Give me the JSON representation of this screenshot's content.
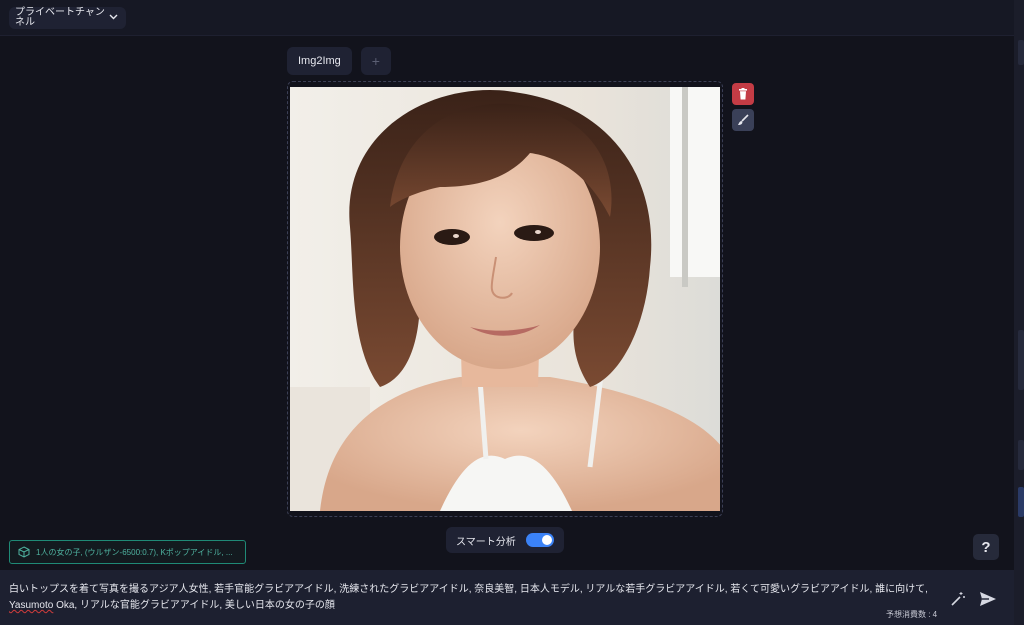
{
  "header": {
    "channel_label": "プライベートチャンネル"
  },
  "tabs": [
    {
      "label": "Img2Img"
    },
    {
      "label": "+"
    }
  ],
  "smart_analysis": {
    "label": "スマート分析",
    "enabled": true
  },
  "model_chip": {
    "label": "1人の女の子, (ウルザン-6500:0.7), Kポップアイドル, ..."
  },
  "help": {
    "label": "?"
  },
  "prompt": {
    "text_before": "白いトップスを着て写真を撮るアジア人女性, 若手官能グラビアアイドル, 洗練されたグラビアアイドル, 奈良美智, 日本人モデル, リアルな若手グラビアアイドル, 若くて可愛いグラビアアイドル, 誰に向けて, ",
    "underlined": "Yasumoto",
    "text_after": " Oka, リアルな官能グラビアアイドル, 美しい日本の女の子の顔"
  },
  "cost": {
    "label": "予想消費数 : 4"
  },
  "colors": {
    "accent": "#3b82f6",
    "delete": "#c43c45",
    "chip": "#1f8a76"
  }
}
